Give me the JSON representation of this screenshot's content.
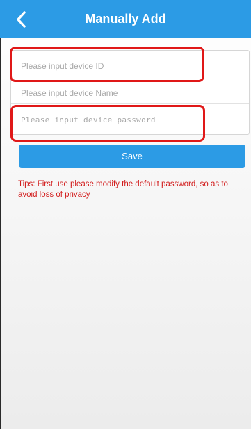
{
  "header": {
    "title": "Manually Add",
    "back_icon": "chevron-left-icon",
    "background_color": "#2c9be5"
  },
  "form": {
    "device_id": {
      "placeholder": "Please input device ID",
      "value": ""
    },
    "device_name": {
      "placeholder": "Please input device Name",
      "value": ""
    },
    "device_password": {
      "placeholder": "Please input device password",
      "value": ""
    }
  },
  "save_button": {
    "label": "Save"
  },
  "tips": {
    "text": "Tips: First use please modify the default password, so as to avoid loss of privacy",
    "color": "#d21c1c"
  },
  "highlight_color": "#e01818"
}
